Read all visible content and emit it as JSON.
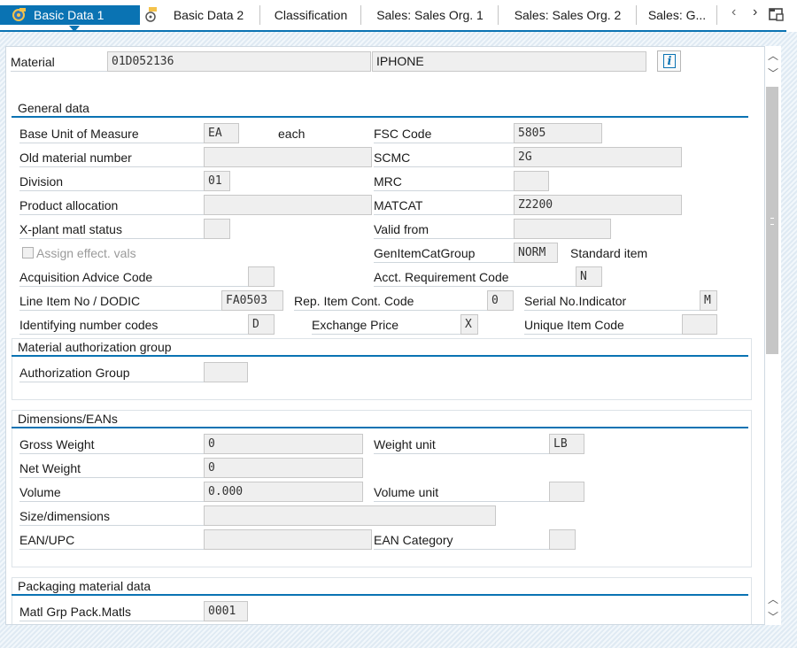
{
  "tabs": [
    {
      "label": "Basic Data 1",
      "active": true
    },
    {
      "label": "Basic Data 2"
    },
    {
      "label": "Classification"
    },
    {
      "label": "Sales: Sales Org. 1"
    },
    {
      "label": "Sales: Sales Org. 2"
    },
    {
      "label": "Sales: G..."
    }
  ],
  "header": {
    "material_label": "Material",
    "material_number": "01D052136",
    "material_description": "IPHONE",
    "info_icon": "info-icon"
  },
  "general": {
    "title": "General data",
    "base_uom_label": "Base Unit of Measure",
    "base_uom_value": "EA",
    "base_uom_text": "each",
    "fsc_label": "FSC Code",
    "fsc_value": "5805",
    "old_mat_label": "Old material number",
    "old_mat_value": "",
    "scmc_label": "SCMC",
    "scmc_value": "2G",
    "division_label": "Division",
    "division_value": "01",
    "mrc_label": "MRC",
    "mrc_value": "",
    "prod_alloc_label": "Product allocation",
    "prod_alloc_value": "",
    "matcat_label": "MATCAT",
    "matcat_value": "Z2200",
    "xplant_label": "X-plant matl status",
    "xplant_value": "",
    "valid_from_label": "Valid from",
    "valid_from_value": "",
    "assign_label": "Assign effect. vals",
    "genitem_label": "GenItemCatGroup",
    "genitem_value": "NORM",
    "genitem_text": "Standard item",
    "acq_label": "Acquisition Advice Code",
    "acq_value": "",
    "acct_label": "Acct. Requirement Code",
    "acct_value": "N",
    "line_item_label": "Line Item No / DODIC",
    "line_item_value": "FA0503",
    "rep_item_label": "Rep. Item Cont. Code",
    "rep_item_value": "0",
    "serial_label": "Serial No.Indicator",
    "serial_value": "M",
    "ident_label": "Identifying number codes",
    "ident_value": "D",
    "exchange_label": "Exchange Price",
    "exchange_value": "X",
    "unique_label": "Unique Item Code",
    "unique_value": ""
  },
  "auth": {
    "title": "Material authorization group",
    "group_label": "Authorization Group",
    "group_value": ""
  },
  "dimensions": {
    "title": "Dimensions/EANs",
    "gross_label": "Gross Weight",
    "gross_value": "0",
    "weight_unit_label": "Weight unit",
    "weight_unit_value": "LB",
    "net_label": "Net Weight",
    "net_value": "0",
    "volume_label": "Volume",
    "volume_value": "0.000",
    "volume_unit_label": "Volume unit",
    "volume_unit_value": "",
    "size_label": "Size/dimensions",
    "size_value": "",
    "ean_label": "EAN/UPC",
    "ean_value": "",
    "ean_cat_label": "EAN Category",
    "ean_cat_value": ""
  },
  "packaging": {
    "title": "Packaging material data",
    "matl_grp_label": "Matl Grp Pack.Matls",
    "matl_grp_value": "0001"
  },
  "colors": {
    "accent": "#0a73b3",
    "field_bg": "#efefef"
  }
}
